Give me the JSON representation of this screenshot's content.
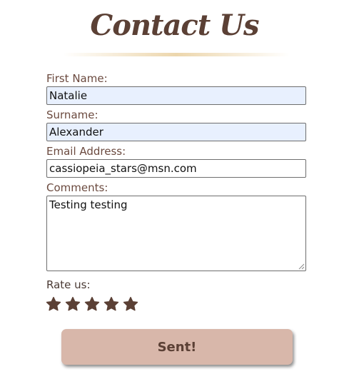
{
  "header": {
    "title": "Contact Us"
  },
  "form": {
    "first_name": {
      "label": "First Name:",
      "value": "Natalie"
    },
    "surname": {
      "label": "Surname:",
      "value": "Alexander"
    },
    "email": {
      "label": "Email Address:",
      "value": "cassiopeia_stars@msn.com"
    },
    "comments": {
      "label": "Comments:",
      "value": "Testing testing"
    },
    "rating": {
      "label": "Rate us:",
      "stars_total": 5,
      "stars_filled": 5
    },
    "submit_label": "Sent!"
  },
  "colors": {
    "brand_brown": "#5b4035",
    "label_brown": "#6b4a3f",
    "button_bg": "#d8b7aa",
    "autofill_bg": "#e8f0fe",
    "divider_gold": "#e9cf9e"
  },
  "icons": [
    "star-icon",
    "resize-grip-icon"
  ]
}
